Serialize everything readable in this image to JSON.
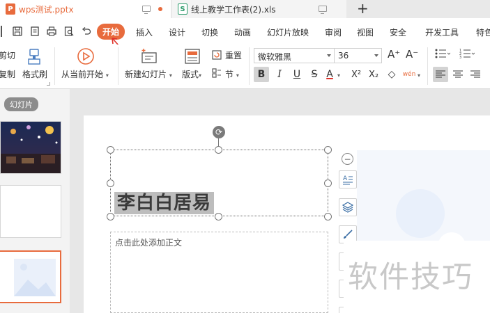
{
  "tabs": [
    {
      "icon": "P",
      "title": "wps测试.pptx",
      "active": true
    },
    {
      "icon": "S",
      "title": "线上教学工作表(2).xls",
      "active": false
    }
  ],
  "new_tab": "+",
  "menu": {
    "items": [
      "开始",
      "插入",
      "设计",
      "切换",
      "动画",
      "幻灯片放映",
      "审阅",
      "视图",
      "安全",
      "开发工具",
      "特色"
    ],
    "active": "开始"
  },
  "ribbon": {
    "cut": "剪切",
    "copy": "复制",
    "format_painter": "格式刷",
    "play_from_current": "从当前开始",
    "new_slide": "新建幻灯片",
    "layout": "版式",
    "reset": "重置",
    "section": "节",
    "font_name": "微软雅黑",
    "font_size": "36",
    "grow_font": "A⁺",
    "shrink_font": "A⁻",
    "bold": "B",
    "italic": "I",
    "underline": "U",
    "strike": "S",
    "font_color": "A",
    "superscript": "X²",
    "subscript": "X₂",
    "clear": "◇",
    "pinyin": "wén"
  },
  "panel": {
    "label": "幻灯片"
  },
  "slide": {
    "title": "李白白居易",
    "body_placeholder": "点击此处添加正文"
  },
  "watermark": "软件技巧",
  "colors": {
    "accent": "#e86b3d",
    "xls_green": "#2a9a6a"
  }
}
